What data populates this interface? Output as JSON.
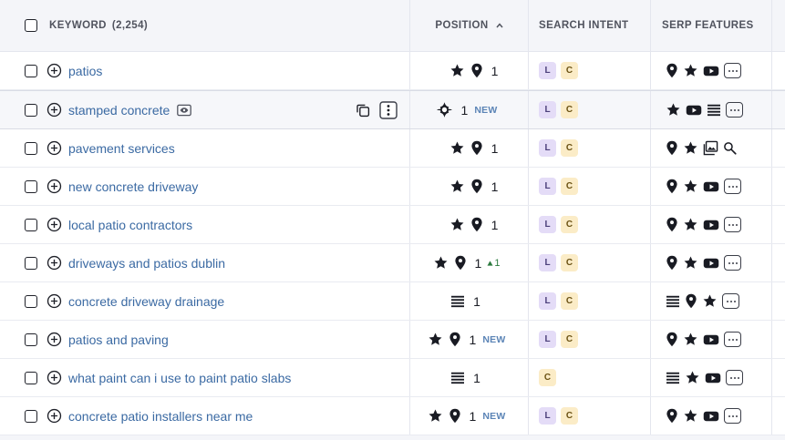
{
  "header": {
    "keyword_label": "KEYWORD",
    "keyword_count": "(2,254)",
    "position_label": "POSITION",
    "intent_label": "SEARCH INTENT",
    "serp_label": "SERP FEATURES"
  },
  "rows": [
    {
      "keyword": "patios",
      "pos_icons": [
        "star",
        "pin"
      ],
      "position": "1",
      "badge": "",
      "delta": "",
      "intents": [
        "L",
        "C"
      ],
      "serp": [
        "pin",
        "star",
        "video",
        "more"
      ]
    },
    {
      "keyword": "stamped concrete",
      "pos_icons": [
        "ai"
      ],
      "position": "1",
      "badge": "NEW",
      "delta": "",
      "intents": [
        "L",
        "C"
      ],
      "serp": [
        "star",
        "video",
        "list",
        "more"
      ]
    },
    {
      "keyword": "pavement services",
      "pos_icons": [
        "star",
        "pin"
      ],
      "position": "1",
      "badge": "",
      "delta": "",
      "intents": [
        "L",
        "C"
      ],
      "serp": [
        "pin",
        "star",
        "image",
        "search"
      ]
    },
    {
      "keyword": "new concrete driveway",
      "pos_icons": [
        "star",
        "pin"
      ],
      "position": "1",
      "badge": "",
      "delta": "",
      "intents": [
        "L",
        "C"
      ],
      "serp": [
        "pin",
        "star",
        "video",
        "more"
      ]
    },
    {
      "keyword": "local patio contractors",
      "pos_icons": [
        "star",
        "pin"
      ],
      "position": "1",
      "badge": "",
      "delta": "",
      "intents": [
        "L",
        "C"
      ],
      "serp": [
        "pin",
        "star",
        "video",
        "more"
      ]
    },
    {
      "keyword": "driveways and patios dublin",
      "pos_icons": [
        "star",
        "pin"
      ],
      "position": "1",
      "badge": "",
      "delta": "1",
      "intents": [
        "L",
        "C"
      ],
      "serp": [
        "pin",
        "star",
        "video",
        "more"
      ]
    },
    {
      "keyword": "concrete driveway drainage",
      "pos_icons": [
        "list"
      ],
      "position": "1",
      "badge": "",
      "delta": "",
      "intents": [
        "L",
        "C"
      ],
      "serp": [
        "list",
        "pin",
        "star",
        "more"
      ]
    },
    {
      "keyword": "patios and paving",
      "pos_icons": [
        "star",
        "pin"
      ],
      "position": "1",
      "badge": "NEW",
      "delta": "",
      "intents": [
        "L",
        "C"
      ],
      "serp": [
        "pin",
        "star",
        "video",
        "more"
      ]
    },
    {
      "keyword": "what paint can i use to paint patio slabs",
      "pos_icons": [
        "list"
      ],
      "position": "1",
      "badge": "",
      "delta": "",
      "intents": [
        "C"
      ],
      "serp": [
        "list",
        "star",
        "video",
        "more"
      ]
    },
    {
      "keyword": "concrete patio installers near me",
      "pos_icons": [
        "star",
        "pin"
      ],
      "position": "1",
      "badge": "NEW",
      "delta": "",
      "intents": [
        "L",
        "C"
      ],
      "serp": [
        "pin",
        "star",
        "video",
        "more"
      ]
    }
  ]
}
